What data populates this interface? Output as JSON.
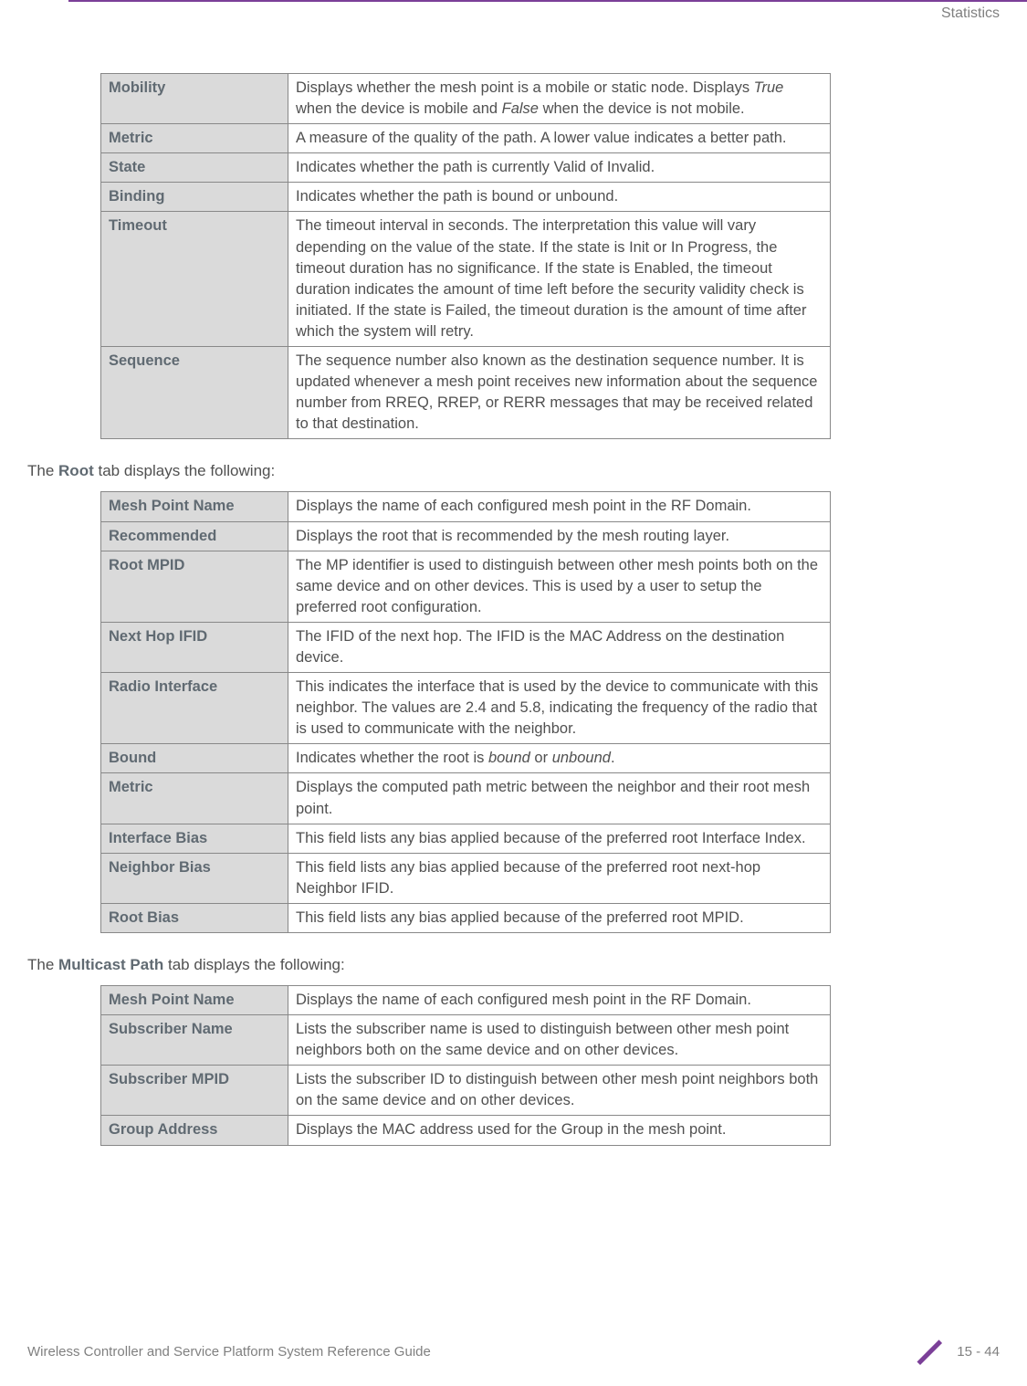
{
  "header": {
    "section": "Statistics"
  },
  "table1": [
    {
      "label": "Mobility",
      "desc": "Displays whether the mesh point is a mobile or static node. Displays <em>True</em> when the device is mobile and <em>False</em> when the device is not mobile."
    },
    {
      "label": "Metric",
      "desc": "A measure of the quality of the path. A lower value indicates a better path."
    },
    {
      "label": "State",
      "desc": "Indicates whether the path is currently Valid of Invalid."
    },
    {
      "label": "Binding",
      "desc": "Indicates whether the path is bound or unbound."
    },
    {
      "label": "Timeout",
      "desc": "The timeout interval in seconds. The interpretation this value will vary depending on the value of the state. If the state is Init or In Progress, the timeout duration has no significance. If the state is Enabled, the timeout duration indicates the amount of time left before the security validity check is initiated. If the state is Failed, the timeout duration is the amount of time after which the system will retry."
    },
    {
      "label": "Sequence",
      "desc": "The sequence number also known as the destination sequence number. It is updated whenever a mesh point receives new information about the sequence number from RREQ, RREP, or RERR messages that may be received related to that destination."
    }
  ],
  "intro2": {
    "pre": "The ",
    "bold": "Root",
    "post": " tab displays the following:"
  },
  "table2": [
    {
      "label": "Mesh Point Name",
      "desc": "Displays the name of each configured mesh point in the RF Domain."
    },
    {
      "label": "Recommended",
      "desc": "Displays the root that is recommended by the mesh routing layer."
    },
    {
      "label": "Root MPID",
      "desc": "The MP identifier is used to distinguish between other mesh points both on the same device and on other devices. This is used by a user to setup the preferred root configuration."
    },
    {
      "label": "Next Hop IFID",
      "desc": "The IFID of the next hop. The IFID is the MAC Address on the destination device."
    },
    {
      "label": "Radio Interface",
      "desc": "This indicates the interface that is used by the device to communicate with this neighbor. The values are 2.4 and 5.8, indicating the frequency of the radio that is used to communicate with the neighbor."
    },
    {
      "label": "Bound",
      "desc": "Indicates whether the root is <em>bound</em> or <em>unbound</em>."
    },
    {
      "label": "Metric",
      "desc": "Displays the computed path metric between the neighbor and their root mesh point."
    },
    {
      "label": "Interface Bias",
      "desc": "This field lists any bias applied because of the preferred root Interface Index."
    },
    {
      "label": "Neighbor Bias",
      "desc": "This field lists any bias applied because of the preferred root next-hop Neighbor IFID."
    },
    {
      "label": "Root Bias",
      "desc": "This field lists any bias applied because of the preferred root MPID."
    }
  ],
  "intro3": {
    "pre": "The ",
    "bold": "Multicast Path",
    "post": " tab displays the following:"
  },
  "table3": [
    {
      "label": "Mesh Point Name",
      "desc": "Displays the name of each configured mesh point in the RF Domain."
    },
    {
      "label": "Subscriber Name",
      "desc": "Lists the subscriber name is used to distinguish between other mesh point neighbors both on the same device and on other devices."
    },
    {
      "label": "Subscriber MPID",
      "desc": "Lists the subscriber ID to distinguish between other mesh point neighbors both on the same device and on other devices."
    },
    {
      "label": "Group Address",
      "desc": "Displays the MAC address used for the Group in the mesh point."
    }
  ],
  "footer": {
    "left": "Wireless Controller and Service Platform System Reference Guide",
    "right": "15 - 44"
  }
}
